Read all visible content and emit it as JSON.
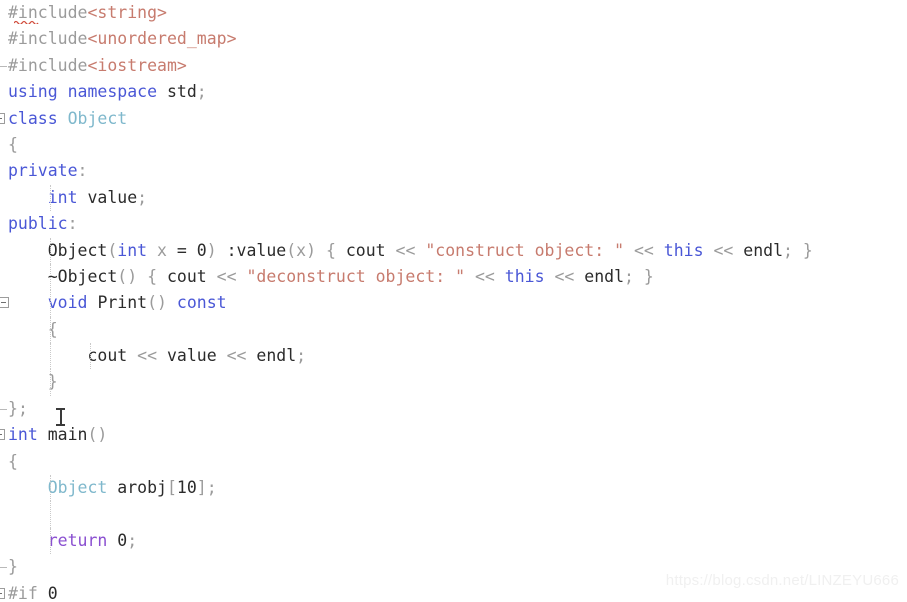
{
  "editor": {
    "language": "C++",
    "theme_background": "#ffffff",
    "colors": {
      "keyword": "#4a57d6",
      "control_keyword": "#8a4fd0",
      "preprocessor": "#9b9b9b",
      "string": "#c77b6e",
      "user_type": "#7fb8cc",
      "plain_text": "#2b2b2b",
      "operator": "#9b9b9b",
      "fold_marker": "#9c9c9c",
      "indent_guide": "#c9c9c9",
      "error_squiggle": "#d04a3a",
      "watermark": "#f0f0f0"
    }
  },
  "watermark": {
    "text": "https://blog.csdn.net/LINZEYU666"
  },
  "code": {
    "lines": [
      {
        "id": "line-1",
        "fold": "none",
        "guides": [],
        "squiggle": true,
        "tokens": [
          {
            "t": "#include",
            "c": "pre"
          },
          {
            "t": "<",
            "c": "angle"
          },
          {
            "t": "string",
            "c": "inc"
          },
          {
            "t": ">",
            "c": "angle"
          }
        ]
      },
      {
        "id": "line-2",
        "fold": "none",
        "guides": [],
        "squiggle": false,
        "tokens": [
          {
            "t": "#include",
            "c": "pre"
          },
          {
            "t": "<",
            "c": "angle"
          },
          {
            "t": "unordered_map",
            "c": "inc"
          },
          {
            "t": ">",
            "c": "angle"
          }
        ]
      },
      {
        "id": "line-3",
        "fold": "end",
        "guides": [],
        "squiggle": false,
        "tokens": [
          {
            "t": "#include",
            "c": "pre"
          },
          {
            "t": "<",
            "c": "angle"
          },
          {
            "t": "iostream",
            "c": "inc"
          },
          {
            "t": ">",
            "c": "angle"
          }
        ]
      },
      {
        "id": "line-4",
        "fold": "none",
        "guides": [],
        "squiggle": false,
        "tokens": [
          {
            "t": "using",
            "c": "key"
          },
          {
            "t": " ",
            "c": "plain"
          },
          {
            "t": "namespace",
            "c": "key"
          },
          {
            "t": " ",
            "c": "plain"
          },
          {
            "t": "std",
            "c": "plain"
          },
          {
            "t": ";",
            "c": "op"
          }
        ]
      },
      {
        "id": "line-5",
        "fold": "open",
        "guides": [],
        "squiggle": false,
        "tokens": [
          {
            "t": "class",
            "c": "key"
          },
          {
            "t": " ",
            "c": "plain"
          },
          {
            "t": "Object",
            "c": "type"
          }
        ]
      },
      {
        "id": "line-6",
        "fold": "bar",
        "guides": [],
        "squiggle": false,
        "tokens": [
          {
            "t": "{",
            "c": "brace"
          }
        ]
      },
      {
        "id": "line-7",
        "fold": "bar",
        "guides": [],
        "squiggle": false,
        "tokens": [
          {
            "t": "private",
            "c": "key"
          },
          {
            "t": ":",
            "c": "op"
          }
        ]
      },
      {
        "id": "line-8",
        "fold": "bar",
        "guides": [
          "g2"
        ],
        "squiggle": false,
        "tokens": [
          {
            "t": "    ",
            "c": "plain"
          },
          {
            "t": "int",
            "c": "key"
          },
          {
            "t": " ",
            "c": "plain"
          },
          {
            "t": "value",
            "c": "plain"
          },
          {
            "t": ";",
            "c": "op"
          }
        ]
      },
      {
        "id": "line-9",
        "fold": "bar",
        "guides": [],
        "squiggle": false,
        "tokens": [
          {
            "t": "public",
            "c": "key"
          },
          {
            "t": ":",
            "c": "op"
          }
        ]
      },
      {
        "id": "line-10",
        "fold": "bar",
        "guides": [
          "g2"
        ],
        "squiggle": false,
        "tokens": [
          {
            "t": "    ",
            "c": "plain"
          },
          {
            "t": "Object",
            "c": "plain"
          },
          {
            "t": "(",
            "c": "op"
          },
          {
            "t": "int",
            "c": "key"
          },
          {
            "t": " ",
            "c": "plain"
          },
          {
            "t": "x",
            "c": "op"
          },
          {
            "t": " = ",
            "c": "plain"
          },
          {
            "t": "0",
            "c": "num"
          },
          {
            "t": ")",
            "c": "op"
          },
          {
            "t": " :",
            "c": "plain"
          },
          {
            "t": "value",
            "c": "plain"
          },
          {
            "t": "(",
            "c": "op"
          },
          {
            "t": "x",
            "c": "op"
          },
          {
            "t": ")",
            "c": "op"
          },
          {
            "t": " ",
            "c": "plain"
          },
          {
            "t": "{",
            "c": "brace"
          },
          {
            "t": " ",
            "c": "plain"
          },
          {
            "t": "cout",
            "c": "plain"
          },
          {
            "t": " ",
            "c": "plain"
          },
          {
            "t": "<<",
            "c": "op"
          },
          {
            "t": " ",
            "c": "plain"
          },
          {
            "t": "\"construct object: \"",
            "c": "str"
          },
          {
            "t": " ",
            "c": "plain"
          },
          {
            "t": "<<",
            "c": "op"
          },
          {
            "t": " ",
            "c": "plain"
          },
          {
            "t": "this",
            "c": "key"
          },
          {
            "t": " ",
            "c": "plain"
          },
          {
            "t": "<<",
            "c": "op"
          },
          {
            "t": " ",
            "c": "plain"
          },
          {
            "t": "endl",
            "c": "plain"
          },
          {
            "t": ";",
            "c": "op"
          },
          {
            "t": " ",
            "c": "plain"
          },
          {
            "t": "}",
            "c": "brace"
          }
        ]
      },
      {
        "id": "line-11",
        "fold": "bar",
        "guides": [
          "g2"
        ],
        "squiggle": false,
        "tokens": [
          {
            "t": "    ",
            "c": "plain"
          },
          {
            "t": "~Object",
            "c": "plain"
          },
          {
            "t": "()",
            "c": "op"
          },
          {
            "t": " ",
            "c": "plain"
          },
          {
            "t": "{",
            "c": "brace"
          },
          {
            "t": " ",
            "c": "plain"
          },
          {
            "t": "cout",
            "c": "plain"
          },
          {
            "t": " ",
            "c": "plain"
          },
          {
            "t": "<<",
            "c": "op"
          },
          {
            "t": " ",
            "c": "plain"
          },
          {
            "t": "\"deconstruct object: \"",
            "c": "str"
          },
          {
            "t": " ",
            "c": "plain"
          },
          {
            "t": "<<",
            "c": "op"
          },
          {
            "t": " ",
            "c": "plain"
          },
          {
            "t": "this",
            "c": "key"
          },
          {
            "t": " ",
            "c": "plain"
          },
          {
            "t": "<<",
            "c": "op"
          },
          {
            "t": " ",
            "c": "plain"
          },
          {
            "t": "endl",
            "c": "plain"
          },
          {
            "t": ";",
            "c": "op"
          },
          {
            "t": " ",
            "c": "plain"
          },
          {
            "t": "}",
            "c": "brace"
          }
        ]
      },
      {
        "id": "line-12",
        "fold": "open-inner",
        "guides": [
          "g2"
        ],
        "squiggle": false,
        "tokens": [
          {
            "t": "    ",
            "c": "plain"
          },
          {
            "t": "void",
            "c": "key"
          },
          {
            "t": " ",
            "c": "plain"
          },
          {
            "t": "Print",
            "c": "plain"
          },
          {
            "t": "()",
            "c": "op"
          },
          {
            "t": " ",
            "c": "plain"
          },
          {
            "t": "const",
            "c": "key"
          }
        ]
      },
      {
        "id": "line-13",
        "fold": "bar",
        "guides": [
          "g2"
        ],
        "squiggle": false,
        "tokens": [
          {
            "t": "    ",
            "c": "plain"
          },
          {
            "t": "{",
            "c": "brace"
          }
        ]
      },
      {
        "id": "line-14",
        "fold": "bar",
        "guides": [
          "g2",
          "g3"
        ],
        "squiggle": false,
        "tokens": [
          {
            "t": "        ",
            "c": "plain"
          },
          {
            "t": "cout",
            "c": "plain"
          },
          {
            "t": " ",
            "c": "plain"
          },
          {
            "t": "<<",
            "c": "op"
          },
          {
            "t": " ",
            "c": "plain"
          },
          {
            "t": "value",
            "c": "plain"
          },
          {
            "t": " ",
            "c": "plain"
          },
          {
            "t": "<<",
            "c": "op"
          },
          {
            "t": " ",
            "c": "plain"
          },
          {
            "t": "endl",
            "c": "plain"
          },
          {
            "t": ";",
            "c": "op"
          }
        ]
      },
      {
        "id": "line-15",
        "fold": "bar",
        "guides": [
          "g2"
        ],
        "squiggle": false,
        "tokens": [
          {
            "t": "    ",
            "c": "plain"
          },
          {
            "t": "}",
            "c": "brace"
          }
        ]
      },
      {
        "id": "line-16",
        "fold": "end",
        "guides": [],
        "squiggle": false,
        "tokens": [
          {
            "t": "}",
            "c": "brace"
          },
          {
            "t": ";",
            "c": "op"
          }
        ]
      },
      {
        "id": "line-17",
        "fold": "open",
        "guides": [],
        "squiggle": false,
        "tokens": [
          {
            "t": "int",
            "c": "key"
          },
          {
            "t": " ",
            "c": "plain"
          },
          {
            "t": "main",
            "c": "plain"
          },
          {
            "t": "()",
            "c": "op"
          }
        ]
      },
      {
        "id": "line-18",
        "fold": "bar",
        "guides": [],
        "squiggle": false,
        "tokens": [
          {
            "t": "{",
            "c": "brace"
          }
        ]
      },
      {
        "id": "line-19",
        "fold": "bar",
        "guides": [
          "g2"
        ],
        "squiggle": false,
        "tokens": [
          {
            "t": "    ",
            "c": "plain"
          },
          {
            "t": "Object",
            "c": "type"
          },
          {
            "t": " ",
            "c": "plain"
          },
          {
            "t": "arobj",
            "c": "plain"
          },
          {
            "t": "[",
            "c": "op"
          },
          {
            "t": "10",
            "c": "num"
          },
          {
            "t": "]",
            "c": "op"
          },
          {
            "t": ";",
            "c": "op"
          }
        ]
      },
      {
        "id": "line-20",
        "fold": "bar",
        "guides": [
          "g2"
        ],
        "squiggle": false,
        "tokens": []
      },
      {
        "id": "line-21",
        "fold": "bar",
        "guides": [
          "g2"
        ],
        "squiggle": false,
        "tokens": [
          {
            "t": "    ",
            "c": "plain"
          },
          {
            "t": "return",
            "c": "ctl"
          },
          {
            "t": " ",
            "c": "plain"
          },
          {
            "t": "0",
            "c": "num"
          },
          {
            "t": ";",
            "c": "op"
          }
        ]
      },
      {
        "id": "line-22",
        "fold": "end",
        "guides": [],
        "squiggle": false,
        "tokens": [
          {
            "t": "}",
            "c": "brace"
          }
        ]
      },
      {
        "id": "line-23",
        "fold": "open",
        "guides": [],
        "squiggle": false,
        "tokens": [
          {
            "t": "#if",
            "c": "pre"
          },
          {
            "t": " ",
            "c": "plain"
          },
          {
            "t": "0",
            "c": "num"
          }
        ]
      }
    ]
  },
  "cursor": {
    "type": "i-beam-text-cursor"
  }
}
